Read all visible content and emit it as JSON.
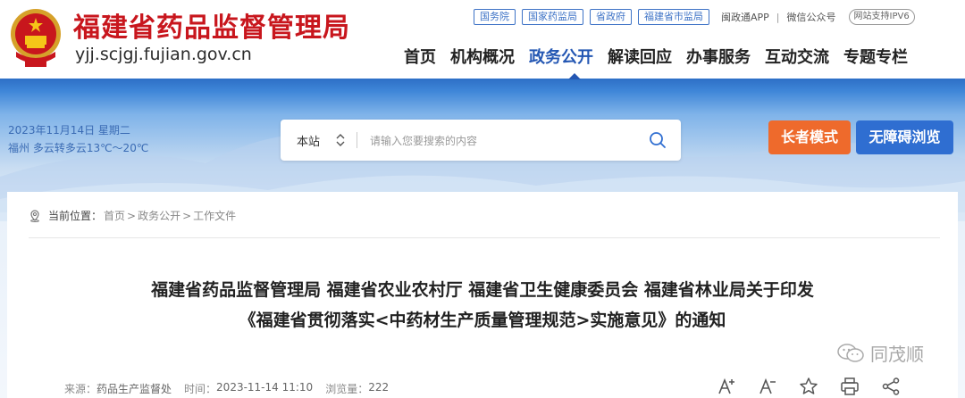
{
  "header": {
    "title": "福建省药品监督管理局",
    "domain": "yjj.scjgj.fujian.gov.cn",
    "emblem": "national-emblem",
    "brand_red": "#c8161d",
    "top_links": [
      "国务院",
      "国家药监局",
      "省政府",
      "福建省市监局"
    ],
    "app_link": "闽政通APP",
    "wechat_link": "微信公众号",
    "ipv6": "网站支持IPV6"
  },
  "nav": {
    "items": [
      "首页",
      "机构概况",
      "政务公开",
      "解读回应",
      "办事服务",
      "互动交流",
      "专题专栏"
    ],
    "active": "政务公开",
    "accent": "#2457b3"
  },
  "banner": {
    "date": "2023年11月14日 星期二",
    "weather": "福州 多云转多云13℃～20℃"
  },
  "search": {
    "scope": "本站",
    "placeholder": "请输入您要搜索的内容",
    "icon": "search-icon"
  },
  "buttons": {
    "elder_mode": "长者模式",
    "accessible": "无障碍浏览",
    "elder_color": "#ee6a2c",
    "accessible_color": "#2f6ed1"
  },
  "breadcrumb": {
    "label": "当前位置：",
    "items": [
      "首页",
      "政务公开",
      "工作文件"
    ]
  },
  "article": {
    "title_line1": "福建省药品监督管理局 福建省农业农村厅 福建省卫生健康委员会 福建省林业局关于印发",
    "title_line2": "《福建省贯彻落实<中药材生产质量管理规范>实施意见》的通知",
    "source_label": "来源：",
    "source": "药品生产监督处",
    "time_label": "时间：",
    "time": "2023-11-14 11:10",
    "views_label": "浏览量：",
    "views": "222",
    "tools": [
      "font-increase-icon",
      "font-decrease-icon",
      "star-icon",
      "print-icon",
      "share-icon"
    ]
  },
  "watermark": {
    "text": "同茂顺",
    "icon": "wechat-icon"
  }
}
